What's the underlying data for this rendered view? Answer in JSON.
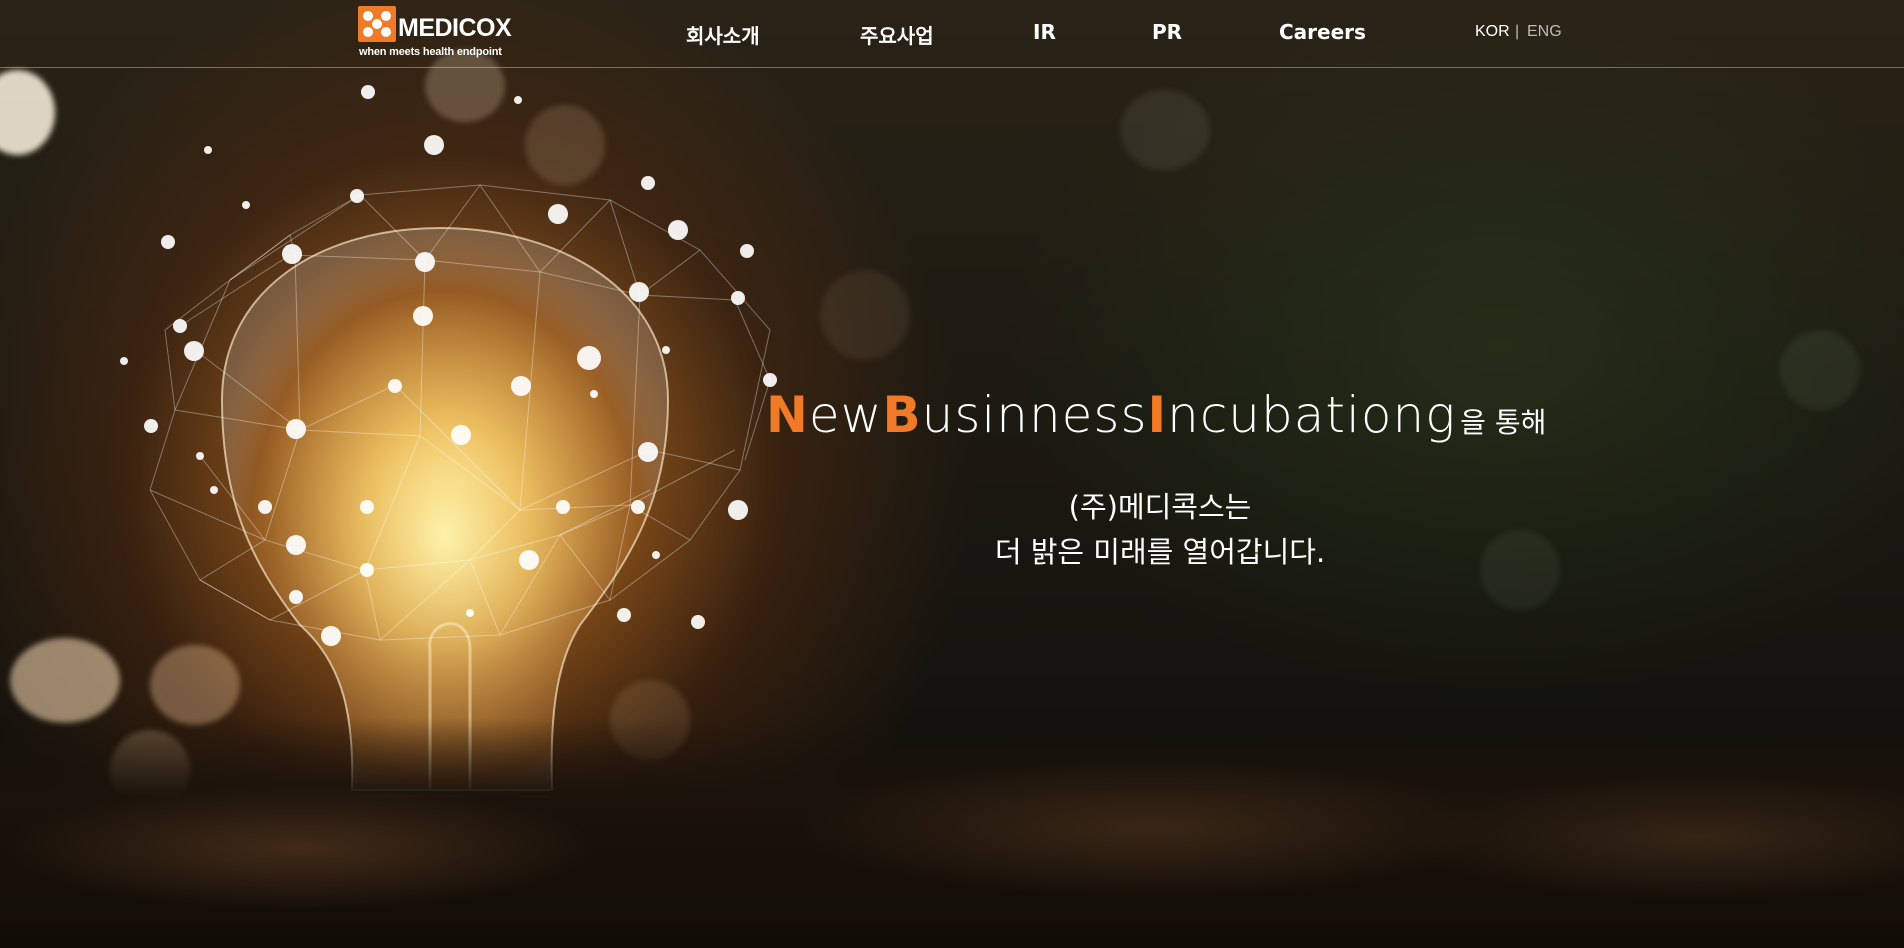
{
  "logo": {
    "name": "MEDICOX",
    "tagline": "when meets health endpoint",
    "brand_color": "#f07a26"
  },
  "nav": {
    "items": [
      "회사소개",
      "주요사업",
      "IR",
      "PR",
      "Careers"
    ]
  },
  "lang": {
    "kor": "KOR",
    "separator": "|",
    "eng": "ENG"
  },
  "hero": {
    "headline": {
      "n_cap": "N",
      "n_rest": "ew",
      "b_cap": "B",
      "b_rest": "usinness",
      "i_cap": "I",
      "i_rest": "ncubationg",
      "suffix": "을 통해"
    },
    "line1": "(주)메디콕스는",
    "line2": "더 밝은 미래를 열어갑니다."
  },
  "colors": {
    "accent": "#f07a26",
    "text": "#ffffff"
  }
}
